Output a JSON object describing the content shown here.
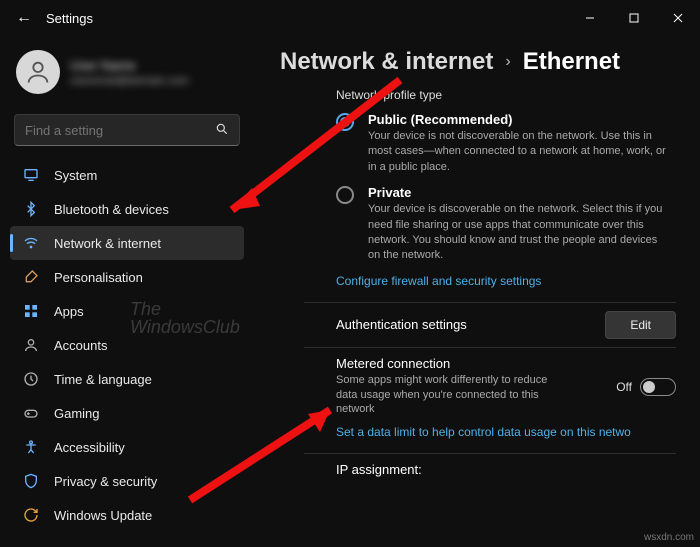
{
  "window": {
    "title": "Settings"
  },
  "profile": {
    "name": "User Name",
    "email": "useremail@domain.com"
  },
  "search": {
    "placeholder": "Find a setting"
  },
  "sidebar": {
    "items": [
      {
        "icon": "system-icon",
        "label": "System"
      },
      {
        "icon": "bluetooth-icon",
        "label": "Bluetooth & devices"
      },
      {
        "icon": "wifi-icon",
        "label": "Network & internet",
        "active": true
      },
      {
        "icon": "brush-icon",
        "label": "Personalisation"
      },
      {
        "icon": "apps-icon",
        "label": "Apps"
      },
      {
        "icon": "accounts-icon",
        "label": "Accounts"
      },
      {
        "icon": "time-icon",
        "label": "Time & language"
      },
      {
        "icon": "gaming-icon",
        "label": "Gaming"
      },
      {
        "icon": "accessibility-icon",
        "label": "Accessibility"
      },
      {
        "icon": "privacy-icon",
        "label": "Privacy & security"
      },
      {
        "icon": "update-icon",
        "label": "Windows Update"
      }
    ]
  },
  "breadcrumb": {
    "parent": "Network & internet",
    "leaf": "Ethernet"
  },
  "content": {
    "profile_heading": "Network profile type",
    "public": {
      "title": "Public (Recommended)",
      "desc": "Your device is not discoverable on the network. Use this in most cases—when connected to a network at home, work, or in a public place."
    },
    "private": {
      "title": "Private",
      "desc": "Your device is discoverable on the network. Select this if you need file sharing or use apps that communicate over this network. You should know and trust the people and devices on the network."
    },
    "firewall_link": "Configure firewall and security settings",
    "auth": {
      "title": "Authentication settings",
      "button": "Edit"
    },
    "metered": {
      "title": "Metered connection",
      "desc": "Some apps might work differently to reduce data usage when you're connected to this network",
      "state": "Off"
    },
    "datalimit_link": "Set a data limit to help control data usage on this netwo",
    "ip_heading": "IP assignment:"
  },
  "watermark": {
    "line1": "The",
    "line2": "WindowsClub"
  },
  "footer": "wsxdn.com"
}
